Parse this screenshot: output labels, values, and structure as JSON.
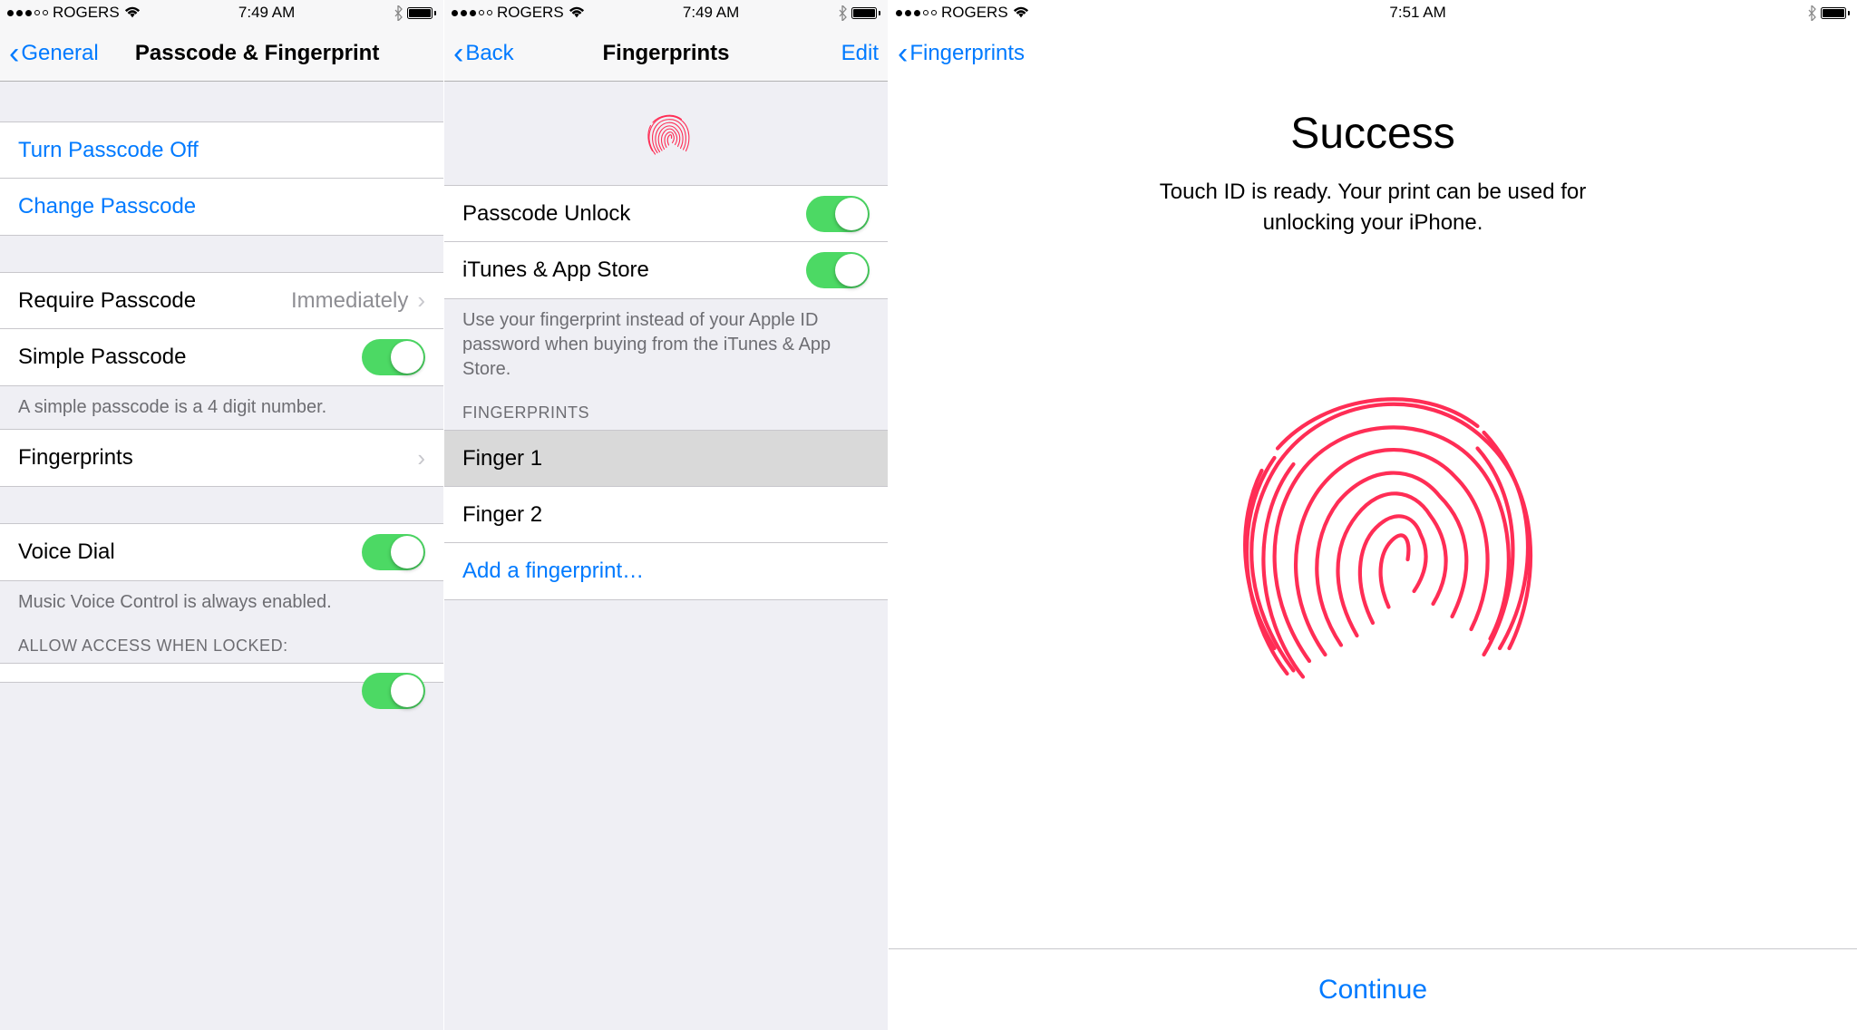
{
  "status": {
    "carrier": "ROGERS",
    "time1": "7:49 AM",
    "time2": "7:49 AM",
    "time3": "7:51 AM"
  },
  "s1": {
    "back": "General",
    "title": "Passcode & Fingerprint",
    "turn_off": "Turn Passcode Off",
    "change": "Change Passcode",
    "require": "Require Passcode",
    "require_val": "Immediately",
    "simple": "Simple Passcode",
    "simple_footer": "A simple passcode is a 4 digit number.",
    "fingerprints": "Fingerprints",
    "voice_dial": "Voice Dial",
    "voice_footer": "Music Voice Control is always enabled.",
    "allow_header": "ALLOW ACCESS WHEN LOCKED:"
  },
  "s2": {
    "back": "Back",
    "title": "Fingerprints",
    "edit": "Edit",
    "passcode_unlock": "Passcode Unlock",
    "itunes": "iTunes & App Store",
    "use_footer": "Use your fingerprint instead of your Apple ID password when buying from the iTunes & App Store.",
    "fp_header": "FINGERPRINTS",
    "finger1": "Finger 1",
    "finger2": "Finger 2",
    "add": "Add a fingerprint…"
  },
  "s3": {
    "back": "Fingerprints",
    "title": "Success",
    "desc": "Touch ID is ready. Your print can be used for unlocking your iPhone.",
    "continue": "Continue"
  }
}
